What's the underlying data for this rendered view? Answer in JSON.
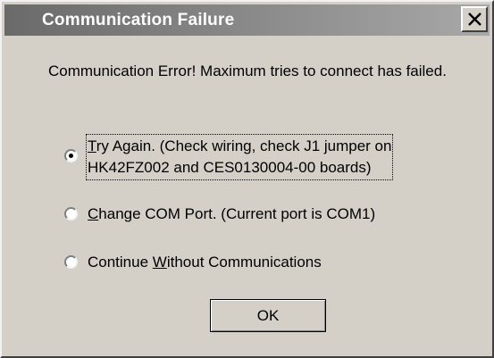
{
  "window": {
    "title": "Communication Failure",
    "close_icon": "close-icon"
  },
  "message": "Communication Error! Maximum tries to connect has failed.",
  "options": [
    {
      "mnemonic": "T",
      "label_rest": "ry Again.  (Check wiring, check J1 jumper on",
      "label_line2": "HK42FZ002 and CES0130004-00 boards)",
      "selected": true
    },
    {
      "mnemonic": "C",
      "label_rest": "hange COM Port.  (Current port is COM1)",
      "selected": false
    },
    {
      "label_prefix": "Continue ",
      "mnemonic": "W",
      "label_rest": "ithout Communications",
      "selected": false
    }
  ],
  "buttons": {
    "ok_label": "OK"
  }
}
